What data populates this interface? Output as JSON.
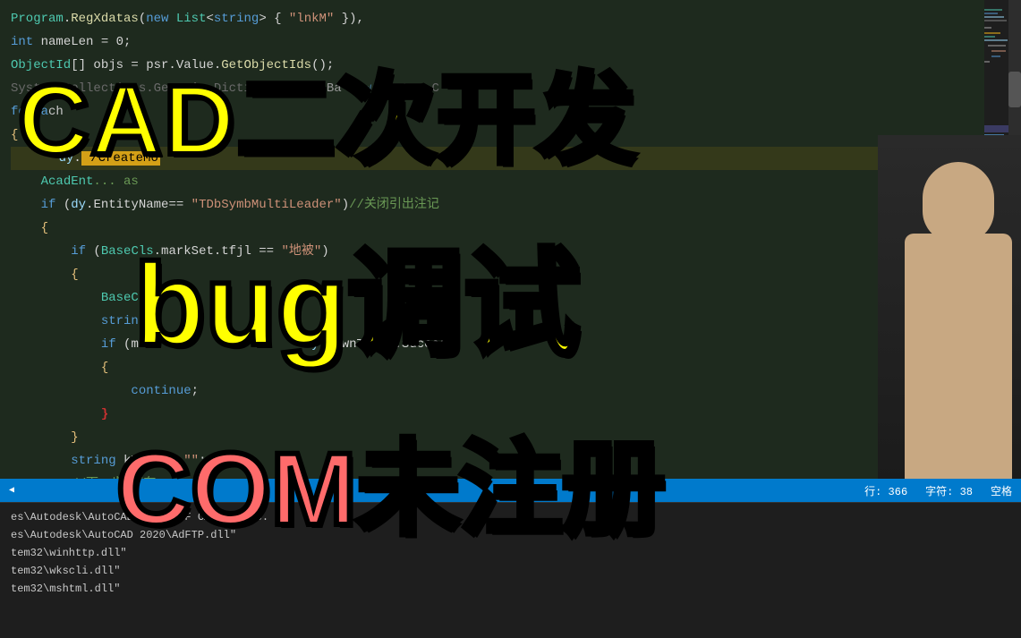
{
  "editor": {
    "background": "#1e2a1e",
    "lines": [
      {
        "id": 1,
        "content": "Program.RegXdatas(new List<string> { \"lnkM\" }),"
      },
      {
        "id": 2,
        "content": "int nameLen = 0;"
      },
      {
        "id": 3,
        "content": "ObjectId[] objs = psr.Value.GetObjectIds();"
      },
      {
        "id": 4,
        "content": "System.Collections.Generic.Dictionary< tr  Ba                    new System.C"
      },
      {
        "id": 5,
        "content": "foreach"
      },
      {
        "id": 6,
        "content": "{"
      },
      {
        "id": 7,
        "content": "    dy.                /CreateMo"
      },
      {
        "id": 8,
        "content": "    AcadEnt...          as"
      },
      {
        "id": 9,
        "content": "    if (dy.EntityName== \"TDbSymbMultiLeader\")//关闭引出注记"
      },
      {
        "id": 10,
        "content": "    {"
      },
      {
        "id": 11,
        "content": "        if (BaseCls.markSet.tfjl == \"地被\")"
      },
      {
        "id": 12,
        "content": "        {"
      },
      {
        "id": 13,
        "content": "            BaseCl"
      },
      {
        "id": 14,
        "content": "            strin"
      },
      {
        "id": 15,
        "content": "            if (m                      dy.DownText).Success)"
      },
      {
        "id": 16,
        "content": "            {"
      },
      {
        "id": 17,
        "content": "                continue;"
      },
      {
        "id": 18,
        "content": "            }"
      },
      {
        "id": 19,
        "content": "        }"
      },
      {
        "id": 20,
        "content": "        string kText = \"\";"
      },
      {
        "id": 21,
        "content": "        //下一步 存在"
      }
    ],
    "statusBar": {
      "row_label": "行: 366",
      "col_label": "字符: 38",
      "space_label": "空格"
    }
  },
  "overlay": {
    "title_cad": "CAD二次开发",
    "title_bug": "bug调试",
    "title_com": "COM未注册"
  },
  "bottom_panel": {
    "lines": [
      "es\\Autodesk\\AutoCAD 2020\\ZIF CAL  ...Ikes.",
      "es\\Autodesk\\AutoCAD 2020\\AdFTP.dll\"",
      "tem32\\winhttp.dll\"",
      "tem32\\wkscli.dll\"",
      "tem32\\mshtml.dll\""
    ]
  },
  "scroll_arrow": "◀"
}
